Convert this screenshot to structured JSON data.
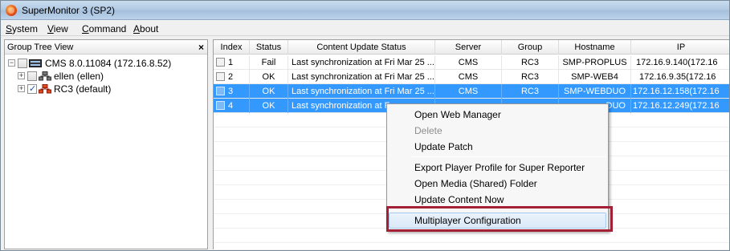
{
  "window": {
    "title": "SuperMonitor 3 (SP2)"
  },
  "menu": [
    "System",
    "View",
    "Command",
    "About"
  ],
  "tree": {
    "header": "Group Tree View",
    "close_glyph": "×",
    "nodes": [
      {
        "label": "CMS  8.0.11084  (172.16.8.52)",
        "expander": "−",
        "checked": false
      },
      {
        "label": "ellen  (ellen)",
        "expander": "+",
        "checked": false
      },
      {
        "label": "RC3  (default)",
        "expander": "+",
        "checked": true
      }
    ]
  },
  "grid": {
    "columns": [
      "Index",
      "Status",
      "Content Update Status",
      "Server",
      "Group",
      "Hostname",
      "IP"
    ],
    "rows": [
      {
        "index": "1",
        "status": "Fail",
        "content": "Last synchronization at Fri Mar 25 ...",
        "server": "CMS",
        "group": "RC3",
        "hostname": "SMP-PROPLUS",
        "ip": "172.16.9.140(172.16",
        "selected": false
      },
      {
        "index": "2",
        "status": "OK",
        "content": "Last synchronization at Fri Mar 25 ...",
        "server": "CMS",
        "group": "RC3",
        "hostname": "SMP-WEB4",
        "ip": "172.16.9.35(172.16",
        "selected": false
      },
      {
        "index": "3",
        "status": "OK",
        "content": "Last synchronization at Fri Mar 25 ...",
        "server": "CMS",
        "group": "RC3",
        "hostname": "SMP-WEBDUO",
        "ip": "172.16.12.158(172.16",
        "selected": true
      },
      {
        "index": "4",
        "status": "OK",
        "content": "Last synchronization at Fr",
        "server": "",
        "group": "",
        "hostname": "DUO",
        "ip": "172.16.12.249(172.16",
        "selected": true
      }
    ]
  },
  "context_menu": {
    "items": [
      {
        "label": "Open Web Manager",
        "disabled": false
      },
      {
        "label": "Delete",
        "disabled": true
      },
      {
        "label": "Update Patch",
        "disabled": false
      },
      {
        "label": "Export Player Profile for Super Reporter",
        "disabled": false
      },
      {
        "label": "Open Media (Shared) Folder",
        "disabled": false
      },
      {
        "label": "Update Content Now",
        "disabled": false
      },
      {
        "label": "Multiplayer Configuration",
        "disabled": false,
        "highlighted": true
      }
    ]
  },
  "colors": {
    "selection": "#3399ff",
    "highlight_border": "#a32136"
  }
}
